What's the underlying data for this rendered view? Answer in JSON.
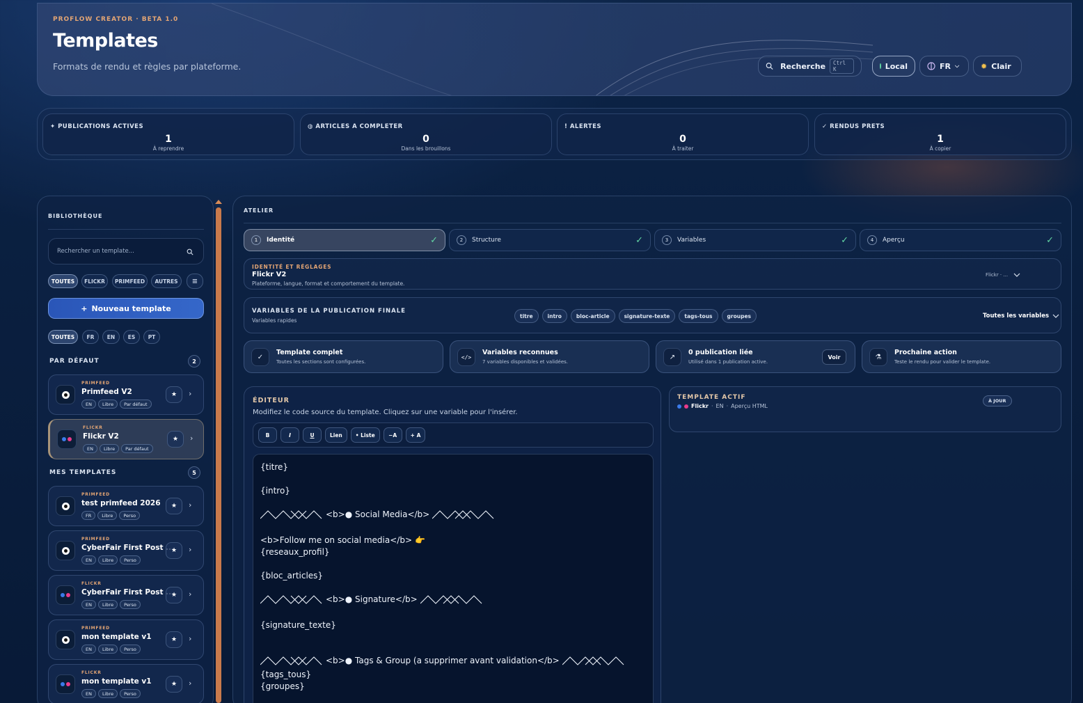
{
  "header": {
    "eyebrow": "PROFLOW CREATOR · BETA 1.0",
    "title": "Templates",
    "subtitle": "Formats de rendu et règles par plateforme.",
    "search_label": "Recherche",
    "search_kbd": "Ctrl K",
    "local_label": "Local",
    "lang_label": "FR",
    "theme_label": "Clair"
  },
  "stats": [
    {
      "label": "✦ PUBLICATIONS ACTIVES",
      "value": "1",
      "sub": "À reprendre"
    },
    {
      "label": "◍ ARTICLES A COMPLETER",
      "value": "0",
      "sub": "Dans les brouillons"
    },
    {
      "label": "! ALERTES",
      "value": "0",
      "sub": "À traiter"
    },
    {
      "label": "✓ RENDUS PRETS",
      "value": "1",
      "sub": "À copier"
    }
  ],
  "library": {
    "title": "BIBLIOTHÈQUE",
    "search_placeholder": "Rechercher un template...",
    "platform_filters": [
      "TOUTES",
      "FLICKR",
      "PRIMFEED",
      "AUTRES"
    ],
    "new_button": "Nouveau template",
    "lang_filters": [
      "TOUTES",
      "FR",
      "EN",
      "ES",
      "PT"
    ],
    "default_section": {
      "title": "PAR DÉFAUT",
      "count": "2"
    },
    "mine_section": {
      "title": "MES TEMPLATES",
      "count": "5"
    },
    "default_templates": [
      {
        "platform": "PRIMFEED",
        "name": "Primfeed V2",
        "tags": [
          "EN",
          "Libre",
          "Par défaut"
        ]
      },
      {
        "platform": "FLICKR",
        "name": "Flickr V2",
        "tags": [
          "EN",
          "Libre",
          "Par défaut"
        ]
      }
    ],
    "my_templates": [
      {
        "platform": "PRIMFEED",
        "name": "test primfeed 2026",
        "tags": [
          "FR",
          "Libre",
          "Perso"
        ]
      },
      {
        "platform": "PRIMFEED",
        "name": "CyberFair First Post ...",
        "tags": [
          "EN",
          "Libre",
          "Perso"
        ]
      },
      {
        "platform": "FLICKR",
        "name": "CyberFair First Post ...",
        "tags": [
          "EN",
          "Libre",
          "Perso"
        ]
      },
      {
        "platform": "PRIMFEED",
        "name": "mon template v1",
        "tags": [
          "EN",
          "Libre",
          "Perso"
        ]
      },
      {
        "platform": "FLICKR",
        "name": "mon template v1",
        "tags": [
          "EN",
          "Libre",
          "Perso"
        ]
      }
    ],
    "star": "★",
    "chevron": "›"
  },
  "atelier": {
    "title": "ATELIER",
    "steps": [
      {
        "num": "1",
        "label": "Identité"
      },
      {
        "num": "2",
        "label": "Structure"
      },
      {
        "num": "3",
        "label": "Variables"
      },
      {
        "num": "4",
        "label": "Aperçu"
      }
    ],
    "check": "✓",
    "identity": {
      "eyebrow": "IDENTITÉ ET RÉGLAGES",
      "name": "Flickr V2",
      "desc": "Plateforme, langue, format et comportement du template.",
      "summary": "Flickr · ..."
    },
    "variables": {
      "title": "VARIABLES DE LA PUBLICATION FINALE",
      "sub": "Variables rapides",
      "chips": [
        "titre",
        "intro",
        "bloc-article",
        "signature-texte",
        "tags-tous",
        "groupes"
      ],
      "all_label": "Toutes les variables"
    },
    "info_cards": [
      {
        "icon": "✓",
        "title": "Template complet",
        "sub": "Toutes les sections sont configurées."
      },
      {
        "icon": "</>",
        "title": "Variables reconnues",
        "sub": "7 variables disponibles et validées."
      },
      {
        "icon": "↗",
        "title": "0 publication liée",
        "sub": "Utilisé dans 1 publication active.",
        "button": "Voir"
      },
      {
        "icon": "⚗",
        "title": "Prochaine action",
        "sub": "Teste le rendu pour valider le template."
      }
    ],
    "editor": {
      "title": "ÉDITEUR",
      "sub": "Modifiez le code source du template. Cliquez sur une variable pour l'insérer.",
      "tools": [
        "B",
        "I",
        "U",
        "Lien",
        "• Liste",
        "−A",
        "+ A"
      ],
      "lines": {
        "l1": "{titre}",
        "l2": "{intro}",
        "l3": "<b>● Social Media</b>",
        "l4": "<b>Follow me on social media</b>",
        "l4_emoji": "👉",
        "l5": "{reseaux_profil}",
        "l6": "{bloc_articles}",
        "l7": "<b>● Signature</b>",
        "l8": "{signature_texte}",
        "l9": "<b>● Tags & Group (a supprimer avant validation</b>",
        "l10": "{tags_tous}",
        "l11": "{groupes}"
      }
    },
    "active_template": {
      "title": "TEMPLATE ACTIF",
      "badge": "À JOUR",
      "platform": "Flickr",
      "lang": "EN",
      "mode": "Aperçu HTML",
      "sep": "·"
    }
  },
  "colors": {
    "accent": "#e3a574",
    "flickr_blue": "#3b7bea",
    "flickr_pink": "#ea3b8a",
    "success": "#62d6a4"
  }
}
